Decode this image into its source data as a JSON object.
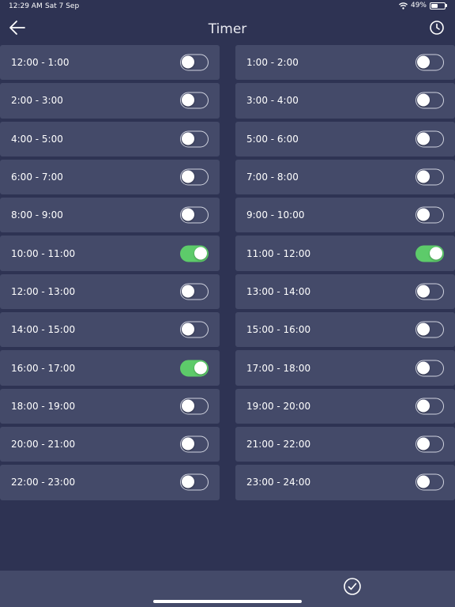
{
  "status_bar": {
    "time": "12:29 AM",
    "date": "Sat 7 Sep",
    "battery": "49%",
    "battery_level": 0.49
  },
  "header": {
    "title": "Timer",
    "back_icon": "arrow-left-icon",
    "history_icon": "clock-icon"
  },
  "colors": {
    "background": "#2e3353",
    "row": "#444a69",
    "toggle_on": "#5dcb6a"
  },
  "slots": [
    {
      "label": "12:00 - 1:00",
      "on": false
    },
    {
      "label": "1:00 - 2:00",
      "on": false
    },
    {
      "label": "2:00 - 3:00",
      "on": false
    },
    {
      "label": "3:00 - 4:00",
      "on": false
    },
    {
      "label": "4:00 - 5:00",
      "on": false
    },
    {
      "label": "5:00 - 6:00",
      "on": false
    },
    {
      "label": "6:00 - 7:00",
      "on": false
    },
    {
      "label": "7:00 - 8:00",
      "on": false
    },
    {
      "label": "8:00 - 9:00",
      "on": false
    },
    {
      "label": "9:00 - 10:00",
      "on": false
    },
    {
      "label": "10:00 - 11:00",
      "on": true
    },
    {
      "label": "11:00 - 12:00",
      "on": true
    },
    {
      "label": "12:00 - 13:00",
      "on": false
    },
    {
      "label": "13:00 - 14:00",
      "on": false
    },
    {
      "label": "14:00 - 15:00",
      "on": false
    },
    {
      "label": "15:00 - 16:00",
      "on": false
    },
    {
      "label": "16:00 - 17:00",
      "on": true
    },
    {
      "label": "17:00 - 18:00",
      "on": false
    },
    {
      "label": "18:00 - 19:00",
      "on": false
    },
    {
      "label": "19:00 - 20:00",
      "on": false
    },
    {
      "label": "20:00 - 21:00",
      "on": false
    },
    {
      "label": "21:00 - 22:00",
      "on": false
    },
    {
      "label": "22:00 - 23:00",
      "on": false
    },
    {
      "label": "23:00 - 24:00",
      "on": false
    }
  ],
  "bottom_bar": {
    "confirm_icon": "checkmark-circle-icon"
  }
}
